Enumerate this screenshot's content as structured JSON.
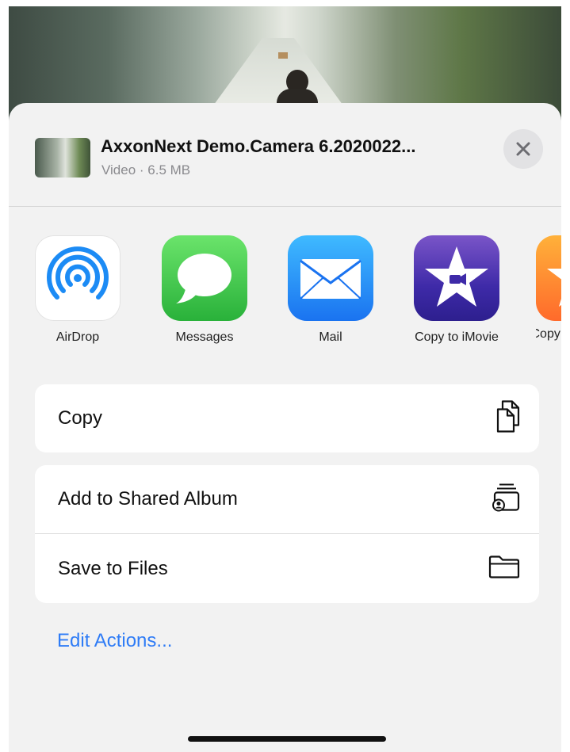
{
  "header": {
    "title": "AxxonNext Demo.Camera 6.2020022...",
    "subtitle": "Video · 6.5 MB"
  },
  "apps": [
    {
      "label": "AirDrop",
      "icon": "airdrop-icon"
    },
    {
      "label": "Messages",
      "icon": "messages-icon"
    },
    {
      "label": "Mail",
      "icon": "mail-icon"
    },
    {
      "label": "Copy to iMovie",
      "icon": "imovie-icon"
    },
    {
      "label": "Copy to iTunes",
      "icon": "itunes-icon"
    }
  ],
  "actions": {
    "copy": "Copy",
    "add_shared_album": "Add to Shared Album",
    "save_files": "Save to Files"
  },
  "edit_actions": "Edit Actions...",
  "colors": {
    "accent": "#2f7cf6",
    "sheet_bg": "#f2f2f2",
    "card_bg": "#ffffff"
  }
}
